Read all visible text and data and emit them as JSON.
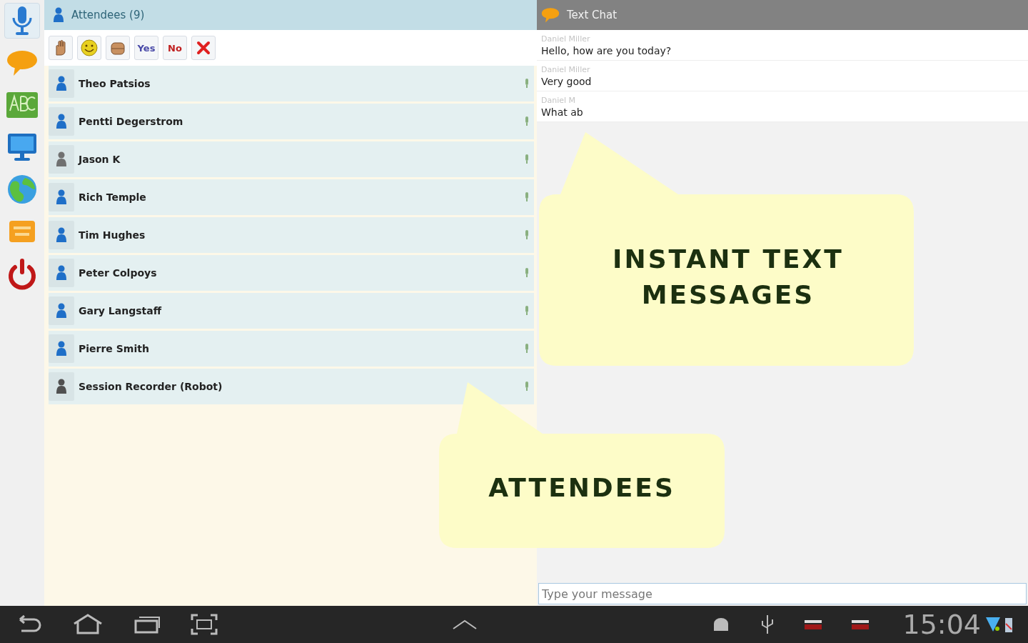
{
  "sidebar": {
    "items": [
      {
        "kind": "mic",
        "selected": true
      },
      {
        "kind": "chat",
        "selected": false
      },
      {
        "kind": "abc",
        "selected": false
      },
      {
        "kind": "screen",
        "selected": false
      },
      {
        "kind": "globe",
        "selected": false
      },
      {
        "kind": "board",
        "selected": false
      },
      {
        "kind": "power",
        "selected": false
      }
    ]
  },
  "attendees": {
    "title": "Attendees (9)",
    "toolbar": [
      {
        "kind": "hand"
      },
      {
        "kind": "smile"
      },
      {
        "kind": "clap"
      },
      {
        "kind": "text",
        "label": "Yes",
        "color": "#4a4aa8"
      },
      {
        "kind": "text",
        "label": "No",
        "color": "#c02020"
      },
      {
        "kind": "clear"
      }
    ],
    "people": [
      {
        "name": "Theo Patsios",
        "color": "#1f6fc8"
      },
      {
        "name": "Pentti Degerstrom",
        "color": "#1f6fc8"
      },
      {
        "name": "Jason K",
        "color": "#707070"
      },
      {
        "name": "Rich Temple",
        "color": "#1f6fc8"
      },
      {
        "name": "Tim Hughes",
        "color": "#1f6fc8"
      },
      {
        "name": "Peter Colpoys",
        "color": "#1f6fc8"
      },
      {
        "name": "Gary Langstaff",
        "color": "#1f6fc8"
      },
      {
        "name": "Pierre Smith",
        "color": "#1f6fc8"
      },
      {
        "name": "Session Recorder (Robot)",
        "color": "#505050"
      }
    ]
  },
  "chat": {
    "title": "Text Chat",
    "messages": [
      {
        "author": "Daniel Miller",
        "text": "Hello, how are you today?"
      },
      {
        "author": "Daniel Miller",
        "text": "Very good"
      },
      {
        "author": "Daniel M",
        "text": "What ab"
      }
    ],
    "input": {
      "placeholder": "Type your message"
    }
  },
  "callouts": [
    {
      "text": "INSTANT TEXT MESSAGES"
    },
    {
      "text": "ATTENDEES"
    }
  ],
  "status_bar": {
    "time": "15:04"
  }
}
